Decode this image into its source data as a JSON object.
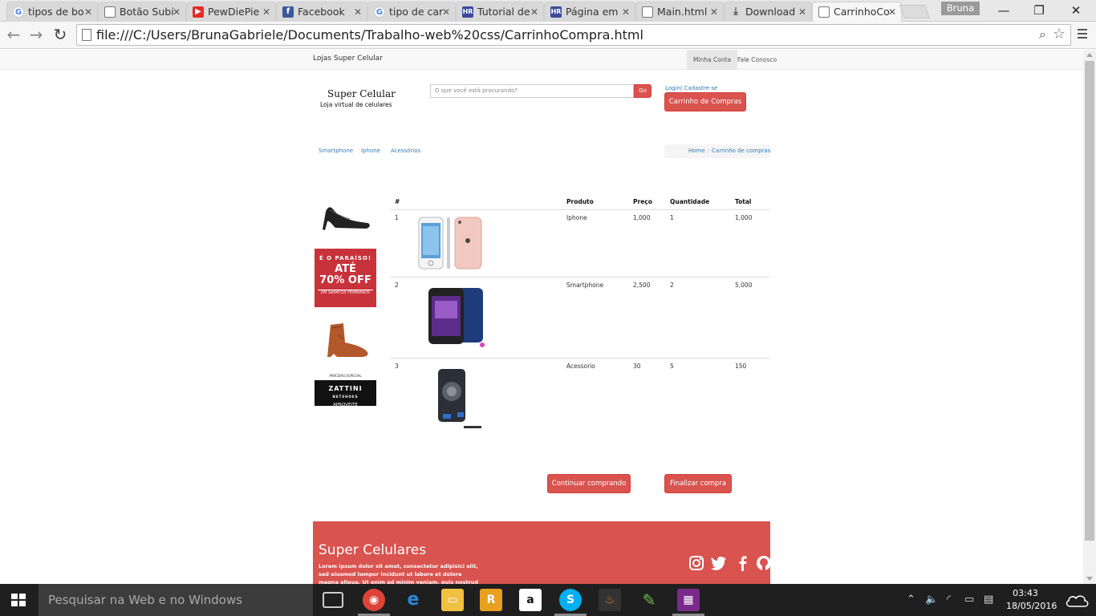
{
  "browser": {
    "tabs": [
      {
        "title": "tipos de bo",
        "favicon": "google-icon"
      },
      {
        "title": "Botão Subi",
        "favicon": "document-icon"
      },
      {
        "title": "PewDiePie",
        "favicon": "youtube-icon"
      },
      {
        "title": "Facebook",
        "favicon": "facebook-icon"
      },
      {
        "title": "tipo de car",
        "favicon": "google-icon"
      },
      {
        "title": "Tutorial de",
        "favicon": "hr-icon"
      },
      {
        "title": "Página em",
        "favicon": "hr-icon"
      },
      {
        "title": "Main.html",
        "favicon": "document-icon"
      },
      {
        "title": "Download",
        "favicon": "download-icon"
      },
      {
        "title": "CarrinhoCo",
        "favicon": "document-icon",
        "active": true
      }
    ],
    "profile_name": "Bruna",
    "url": "file:///C:/Users/BrunaGabriele/Documents/Trabalho-web%20css/CarrinhoCompra.html"
  },
  "site": {
    "topnav": {
      "brand": "Lojas Super Celular",
      "links": [
        "Minha Conta",
        "Fale Conosco"
      ]
    },
    "logo": {
      "title": "Super Celular",
      "subtitle": "Loja virtual de celulares"
    },
    "search": {
      "placeholder": "O que você está procurando?",
      "button": "Go"
    },
    "auth_links": "Login| Cadastre-se",
    "cart_button": "Carrinho de Compras",
    "categories": [
      "Smartphone",
      "Iphone",
      "Acessórios"
    ],
    "breadcrumb": {
      "home": "Home",
      "separator": "/",
      "current": "Carrinho de compras"
    },
    "ads": {
      "promo": {
        "line1": "É O PARAÍSO!",
        "line2": "ATÉ",
        "line3": "70% OFF",
        "line4": "EM SAPATOS FEMININOS"
      },
      "zattini": {
        "small": "PARCEIRO ESPECIAL",
        "brand": "ZATTINI",
        "tag": "NETSHOES",
        "cta": "APROVEITE"
      }
    },
    "cart": {
      "headers": {
        "num": "#",
        "product": "Produto",
        "price": "Preço",
        "qty": "Quantidade",
        "total": "Total"
      },
      "rows": [
        {
          "num": "1",
          "product": "Iphone",
          "price": "1,000",
          "qty": "1",
          "total": "1,000"
        },
        {
          "num": "2",
          "product": "Smartphone",
          "price": "2,500",
          "qty": "2",
          "total": "5,000"
        },
        {
          "num": "3",
          "product": "Acessorio",
          "price": "30",
          "qty": "5",
          "total": "150"
        }
      ]
    },
    "buttons": {
      "continue": "Continuar comprando",
      "checkout": "Finalizar compra"
    },
    "footer": {
      "title": "Super Celulares",
      "text": "Lorem ipsum dolor sit amet, consectetur adipisici elit, sed eiusmod tempor incidunt ut labore et dolore magna aliqua. Ut enim ad minim veniam, quis nostrud",
      "social": [
        "instagram-icon",
        "twitter-icon",
        "facebook-icon",
        "github-icon"
      ]
    }
  },
  "taskbar": {
    "search_placeholder": "Pesquisar na Web e no Windows",
    "time": "03:43",
    "date": "18/05/2016"
  },
  "colors": {
    "accent": "#d9534f",
    "link": "#337ab7"
  }
}
